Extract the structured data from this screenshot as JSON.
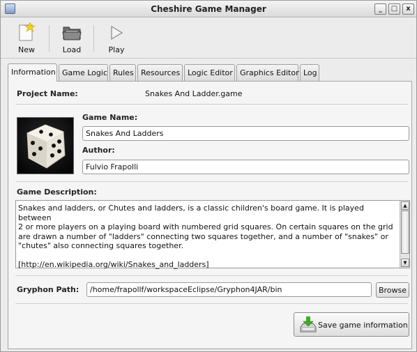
{
  "window": {
    "title": "Cheshire Game Manager",
    "controls": {
      "minimize": "_",
      "maximize": "□",
      "close": "x"
    }
  },
  "toolbar": {
    "new_label": "New",
    "load_label": "Load",
    "play_label": "Play"
  },
  "tabs": [
    {
      "label": "Information",
      "active": true
    },
    {
      "label": "Game Logic"
    },
    {
      "label": "Rules"
    },
    {
      "label": "Resources"
    },
    {
      "label": "Logic Editor"
    },
    {
      "label": "Graphics Editor"
    },
    {
      "label": "Log"
    }
  ],
  "info": {
    "project_name_label": "Project Name:",
    "project_name_value": "Snakes And Ladder.game",
    "game_name_label": "Game Name:",
    "game_name_value": "Snakes And Ladders",
    "author_label": "Author:",
    "author_value": "Fulvio Frapolli",
    "description_label": "Game Description:",
    "description_lines": [
      "Snakes and ladders, or Chutes and ladders, is a classic children's board game. It is played between",
      "2 or more players on a playing board with numbered grid  squares. On certain squares on the grid",
      "are drawn a number of \"ladders\"  connecting two squares together, and a number of \"snakes\" or",
      "\"chutes\" also  connecting squares together.",
      "",
      "[http://en.wikipedia.org/wiki/Snakes_and_ladders]"
    ],
    "gryphon_path_label": "Gryphon Path:",
    "gryphon_path_value": "/home/frapollf/workspaceEclipse/Gryphon4JAR/bin",
    "browse_label": "Browse",
    "save_label": "Save game information"
  },
  "colors": {
    "save_icon_green": "#3fae2a",
    "new_icon_star": "#f2d21e"
  },
  "icons": {
    "new": "new-document-icon",
    "load": "folder-icon",
    "play": "play-icon",
    "save": "save-download-icon",
    "game_image": "dice-icon"
  }
}
